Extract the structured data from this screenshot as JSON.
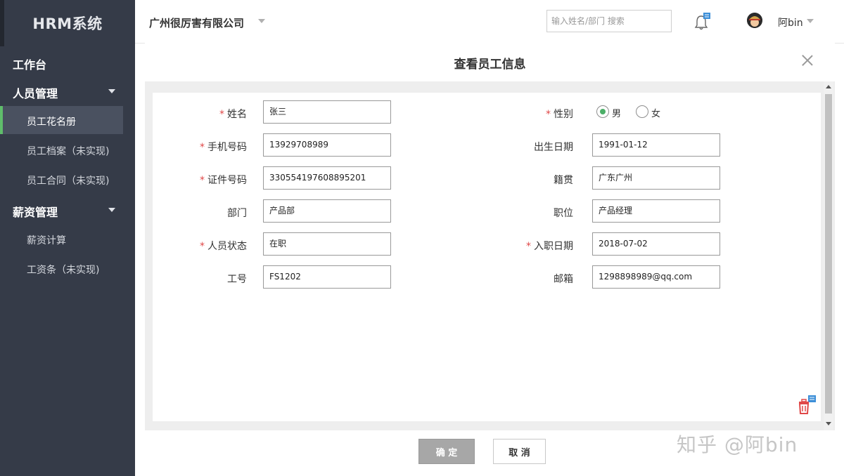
{
  "sidebar": {
    "brand": "HRM系统",
    "workbench": "工作台",
    "groups": [
      {
        "label": "人员管理",
        "items": [
          {
            "label": "员工花名册",
            "active": true
          },
          {
            "label": "员工档案（未实现)"
          },
          {
            "label": "员工合同（未实现)"
          }
        ]
      },
      {
        "label": "薪资管理",
        "items": [
          {
            "label": "薪资计算"
          },
          {
            "label": "工资条（未实现)"
          }
        ]
      }
    ]
  },
  "header": {
    "company": "广州很厉害有限公司",
    "search_placeholder": "输入姓名/部门 搜索",
    "username": "阿bin"
  },
  "dialog": {
    "title": "查看员工信息",
    "left_fields": [
      {
        "label": "姓名",
        "required": true,
        "value": "张三"
      },
      {
        "label": "手机号码",
        "required": true,
        "value": "13929708989"
      },
      {
        "label": "证件号码",
        "required": true,
        "value": " 330554197608895201"
      },
      {
        "label": "部门",
        "required": false,
        "value": "产品部"
      },
      {
        "label": "人员状态",
        "required": true,
        "value": "在职"
      },
      {
        "label": "工号",
        "required": false,
        "value": "FS1202"
      }
    ],
    "gender": {
      "label": "性别",
      "required": true,
      "options": [
        "男",
        "女"
      ],
      "selected": "男"
    },
    "right_fields": [
      {
        "label": "出生日期",
        "required": false,
        "value": "1991-01-12"
      },
      {
        "label": "籍贯",
        "required": false,
        "value": "广东广州"
      },
      {
        "label": "职位",
        "required": false,
        "value": "产品经理"
      },
      {
        "label": "入职日期",
        "required": true,
        "value": "2018-07-02"
      },
      {
        "label": "邮箱",
        "required": false,
        "value": "1298898989@qq.com"
      }
    ],
    "confirm_label": "确 定",
    "cancel_label": "取 消"
  },
  "watermark": "知乎 @阿bin",
  "colors": {
    "sidebar_bg": "#353b48",
    "active_bar": "#5fbd6b",
    "required": "#e04848",
    "radio_checked": "#4caf68",
    "trash": "#e04848"
  },
  "icons": [
    "chevron-down-icon",
    "bell-icon",
    "avatar",
    "close-icon",
    "trash-icon"
  ]
}
